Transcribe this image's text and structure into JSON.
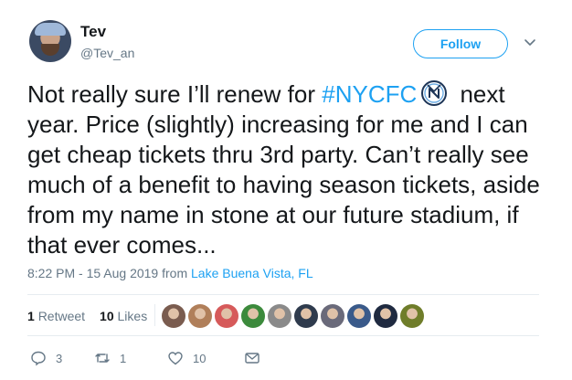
{
  "user": {
    "name": "Tev",
    "handle": "@Tev_an"
  },
  "follow_label": "Follow",
  "tweet": {
    "text_before": "Not really sure I’ll renew for ",
    "hashtag": "#NYCFC",
    "text_after": " next year. Price (slightly) increasing for me and I can get cheap tickets thru 3rd party. Can’t really see much of a benefit to having season tickets, aside from my name in stone at our future stadium, if that ever comes..."
  },
  "meta": {
    "timestamp": "8:22 PM - 15 Aug 2019",
    "from_label": "from",
    "location": "Lake Buena Vista, FL"
  },
  "stats": {
    "retweets_count": "1",
    "retweets_label": "Retweet",
    "likes_count": "10",
    "likes_label": "Likes"
  },
  "likers": [
    {
      "color": "#7a5c4f",
      "icon": "avatar"
    },
    {
      "color": "#b07f5a",
      "icon": "avatar"
    },
    {
      "color": "#d65a5a",
      "icon": "avatar"
    },
    {
      "color": "#3c8a3c",
      "icon": "avatar"
    },
    {
      "color": "#8a8a8a",
      "icon": "avatar"
    },
    {
      "color": "#2f3b4d",
      "icon": "avatar"
    },
    {
      "color": "#6a6a7a",
      "icon": "avatar"
    },
    {
      "color": "#3a5a8a",
      "icon": "avatar"
    },
    {
      "color": "#1f2a40",
      "icon": "avatar"
    },
    {
      "color": "#6f7d2a",
      "icon": "avatar"
    }
  ],
  "actions": {
    "reply_count": "3",
    "retweet_count": "1",
    "like_count": "10"
  },
  "colors": {
    "accent": "#1da1f2",
    "text": "#14171a",
    "secondary": "#657786"
  }
}
